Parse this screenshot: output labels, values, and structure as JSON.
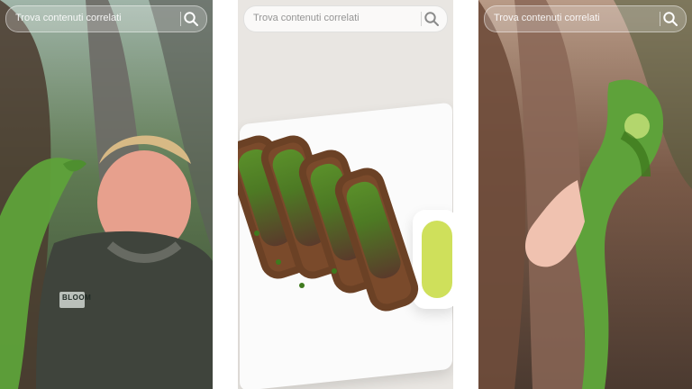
{
  "panels": [
    {
      "id": "video-1",
      "search": {
        "placeholder": "Trova contenuti correlati",
        "icon": "search-icon"
      }
    },
    {
      "id": "video-2",
      "search": {
        "placeholder": "Trova contenuti correlati",
        "icon": "search-icon"
      }
    },
    {
      "id": "video-3",
      "search": {
        "placeholder": "Trova contenuti correlati",
        "icon": "search-icon"
      }
    }
  ],
  "video_1": {
    "hoodie_logo": "BLOOM"
  },
  "colors": {
    "iguana_green": "#5ea23a",
    "sauce_green": "#cfe05b",
    "plate_white": "#fbfbfb"
  }
}
